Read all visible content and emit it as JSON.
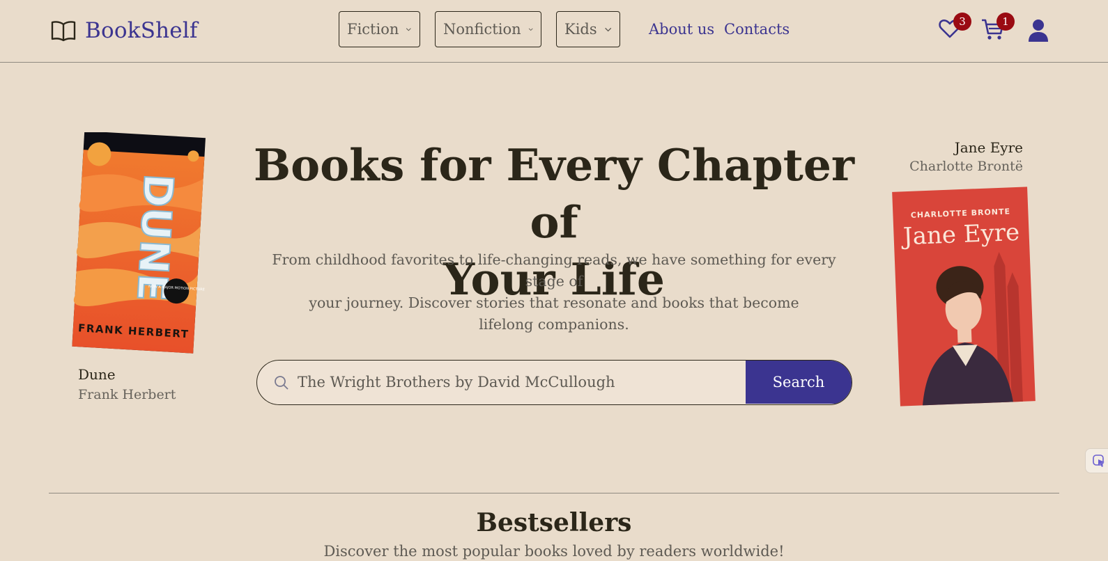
{
  "brand": {
    "name": "BookShelf",
    "logo_icon": "open-book-icon"
  },
  "nav": {
    "dropdowns": [
      {
        "label": "Fiction"
      },
      {
        "label": "Nonfiction"
      },
      {
        "label": "Kids"
      }
    ],
    "links": [
      {
        "label": "About us"
      },
      {
        "label": "Contacts"
      }
    ],
    "wishlist_count": "3",
    "cart_count": "1"
  },
  "hero": {
    "title_line1": "Books for Every Chapter of",
    "title_line2": "Your Life",
    "subtitle_line1": "From childhood favorites to life-changing reads, we have something for every stage of",
    "subtitle_line2": "your journey. Discover stories that resonate and books that become",
    "subtitle_line3": "lifelong companions.",
    "search": {
      "value": "The Wright Brothers by David McCullough",
      "button": "Search"
    }
  },
  "featured_books": {
    "left": {
      "title": "Dune",
      "author": "Frank Herbert",
      "cover_title": "DUNE",
      "cover_author": "FRANK HERBERT",
      "cover_badge": "NOW A MAJOR MOTION PICTURE"
    },
    "right": {
      "title": "Jane Eyre",
      "author": "Charlotte Brontë",
      "cover_title": "Jane Eyre",
      "cover_author": "CHARLOTTE BRONTE"
    }
  },
  "bestsellers": {
    "title": "Bestsellers",
    "subtitle": "Discover the most popular books loved by readers worldwide!"
  },
  "colors": {
    "background": "#e9dccb",
    "accent": "#3b3490",
    "badge": "#9a0b12",
    "text": "#2b2619"
  }
}
